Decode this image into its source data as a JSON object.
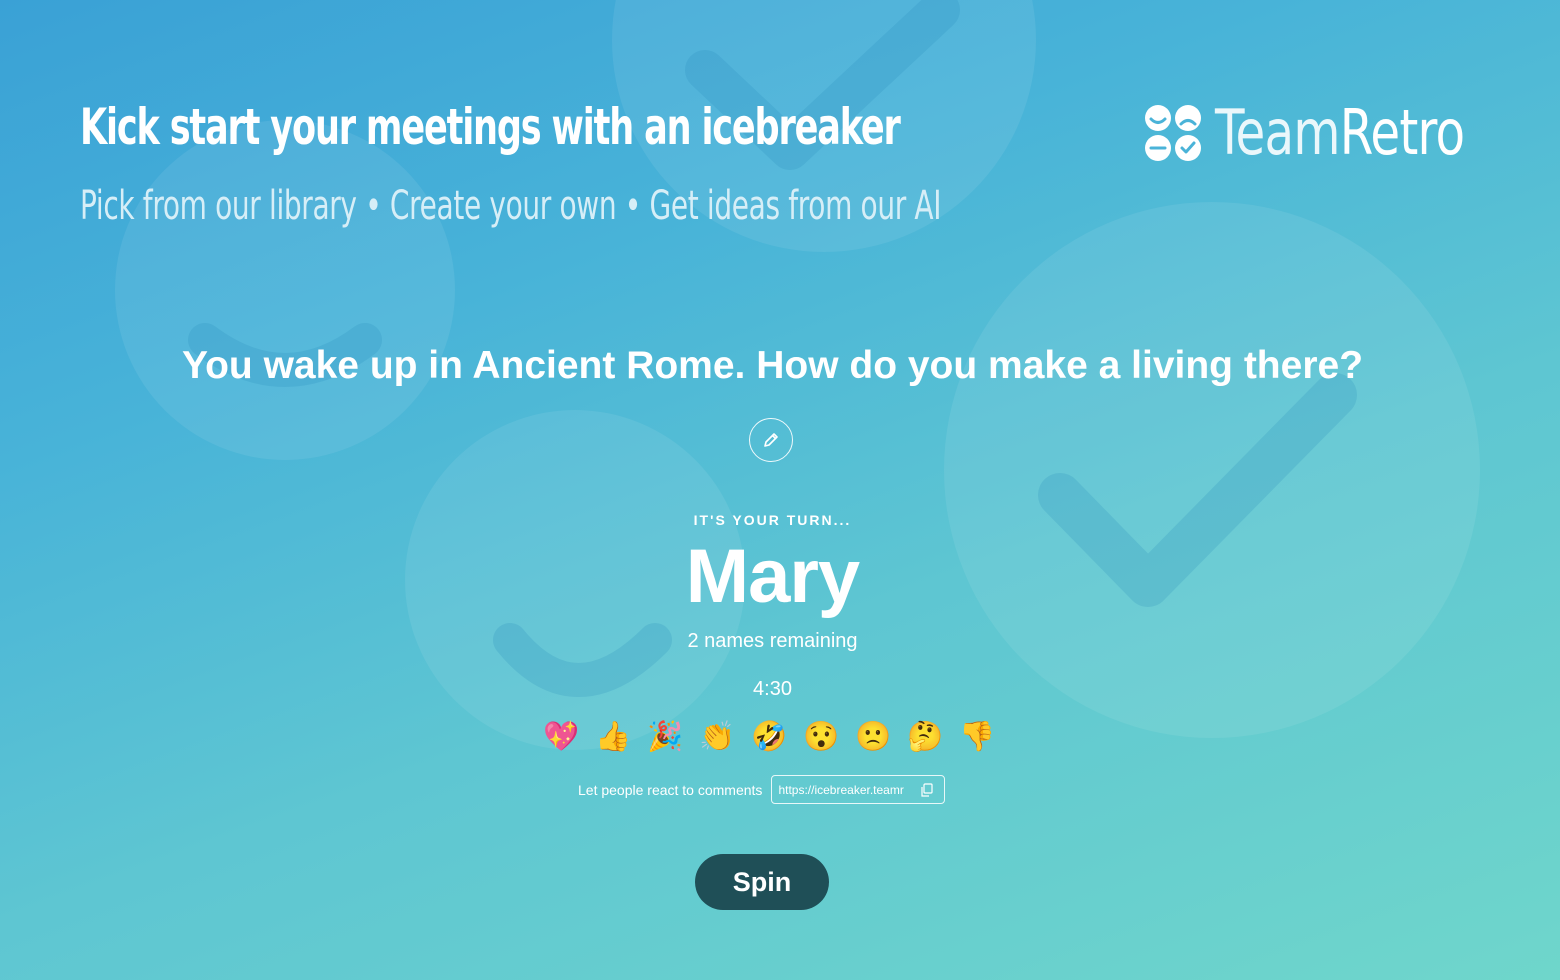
{
  "header": {
    "headline": "Kick start your meetings with an icebreaker",
    "subline": "Pick from our library • Create your own • Get ideas from our AI"
  },
  "brand": {
    "name_part1": "Team",
    "name_part2": "Retro",
    "icon": "teamretro-logo-icon"
  },
  "main": {
    "question": "You wake up in Ancient Rome. How do you make a living there?",
    "edit_icon": "pencil-icon",
    "turn_label": "IT'S YOUR TURN...",
    "current_name": "Mary",
    "remaining": "2 names remaining",
    "timer": "4:30"
  },
  "reactions": [
    {
      "emoji": "💖",
      "icon": "sparkling-heart-icon"
    },
    {
      "emoji": "👍",
      "icon": "thumbs-up-icon"
    },
    {
      "emoji": "🎉",
      "icon": "party-popper-icon"
    },
    {
      "emoji": "👏",
      "icon": "clapping-hands-icon"
    },
    {
      "emoji": "🤣",
      "icon": "rolling-laughing-icon"
    },
    {
      "emoji": "😯",
      "icon": "surprised-face-icon"
    },
    {
      "emoji": "🙁",
      "icon": "frowning-face-icon"
    },
    {
      "emoji": "🤔",
      "icon": "thinking-face-icon"
    },
    {
      "emoji": "👎",
      "icon": "thumbs-down-icon"
    }
  ],
  "share": {
    "label": "Let people react to comments",
    "link": "https://icebreaker.teamr",
    "copy_icon": "copy-icon"
  },
  "actions": {
    "spin_label": "Spin"
  },
  "colors": {
    "background_start": "#3aa1d6",
    "background_end": "#6fd6cb",
    "spin_button": "#1f4f57",
    "text": "#ffffff"
  }
}
